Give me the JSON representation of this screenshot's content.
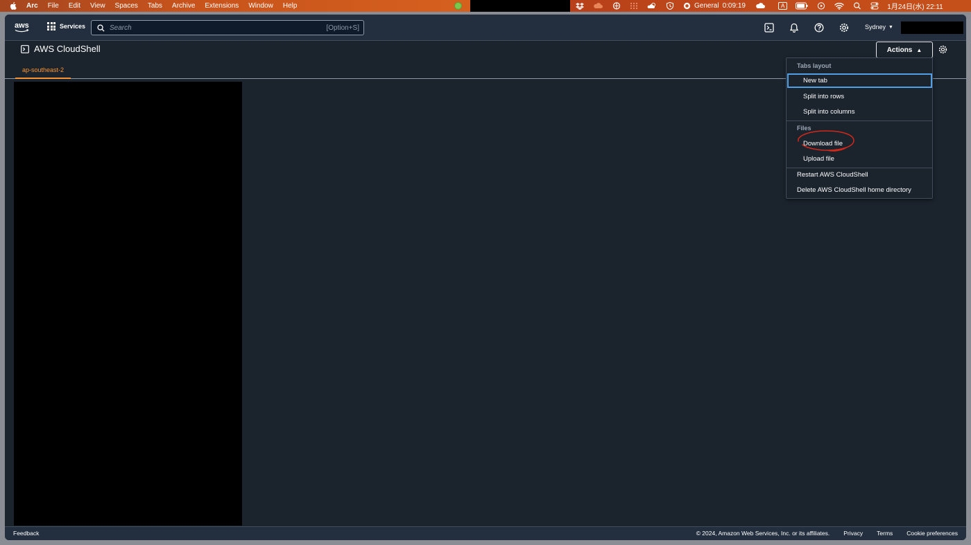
{
  "menubar": {
    "app": "Arc",
    "items": [
      "File",
      "Edit",
      "View",
      "Spaces",
      "Tabs",
      "Archive",
      "Extensions",
      "Window",
      "Help"
    ],
    "status_label": "General",
    "timer": "0:09:19",
    "input_method": "A",
    "datetime": "1月24日(水)  22:11"
  },
  "aws_nav": {
    "logo_text": "aws",
    "services_label": "Services",
    "search_placeholder": "Search",
    "search_shortcut": "[Option+S]",
    "region_label": "Sydney"
  },
  "page": {
    "title": "AWS CloudShell",
    "actions_label": "Actions",
    "tabs": [
      {
        "label": "ap-southeast-2",
        "active": true
      }
    ]
  },
  "actions_menu": {
    "groups": [
      {
        "title": "Tabs layout",
        "items": [
          "New tab",
          "Split into rows",
          "Split into columns"
        ]
      },
      {
        "title": "Files",
        "items": [
          "Download file",
          "Upload file"
        ]
      }
    ],
    "top_level_items": [
      "Restart AWS CloudShell",
      "Delete AWS CloudShell home directory"
    ],
    "focused_item": "New tab",
    "highlighted_item": "Download file"
  },
  "footer": {
    "feedback": "Feedback",
    "copyright": "© 2024, Amazon Web Services, Inc. or its affiliates.",
    "links": [
      "Privacy",
      "Terms",
      "Cookie preferences"
    ]
  },
  "colors": {
    "accent_orange": "#f79435",
    "focus_blue": "#539fe5",
    "annotation_red": "#d0291c",
    "nav_bg": "#232f3e",
    "page_bg": "#1b232d"
  }
}
